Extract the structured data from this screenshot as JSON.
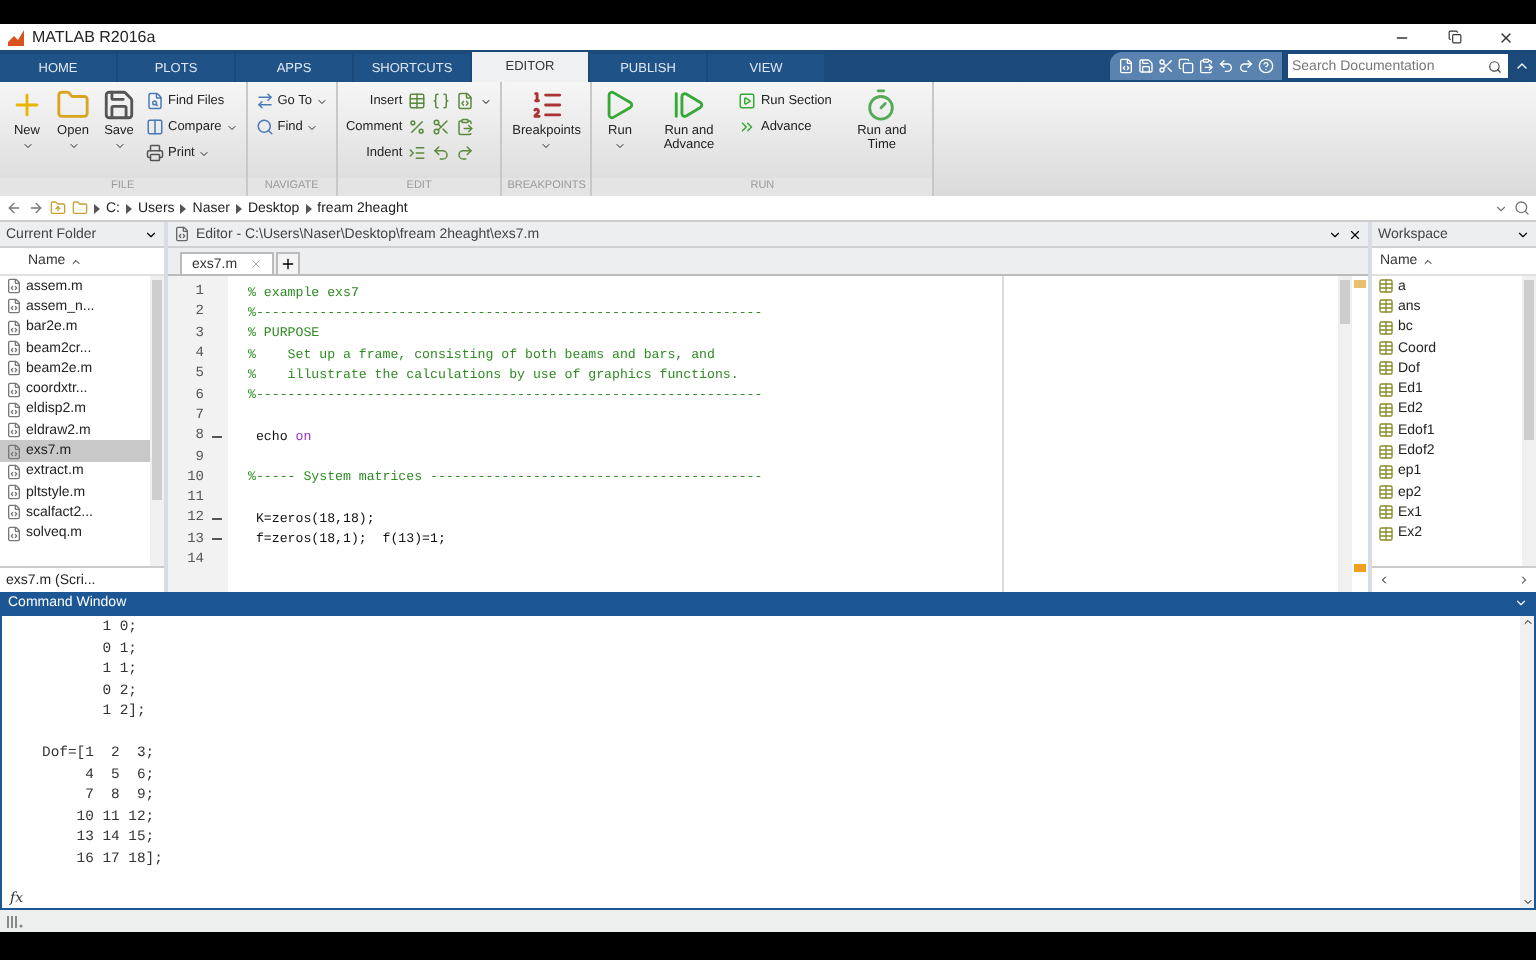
{
  "window": {
    "title": "MATLAB R2016a"
  },
  "tabs": [
    {
      "label": "HOME",
      "selected": false
    },
    {
      "label": "PLOTS",
      "selected": false
    },
    {
      "label": "APPS",
      "selected": false
    },
    {
      "label": "SHORTCUTS",
      "selected": false
    },
    {
      "label": "EDITOR",
      "selected": true
    },
    {
      "label": "PUBLISH",
      "selected": false
    },
    {
      "label": "VIEW",
      "selected": false
    }
  ],
  "search": {
    "placeholder": "Search Documentation"
  },
  "toolstrip": [
    {
      "label": "FILE",
      "columns": [
        {
          "kind": "large",
          "label": "New",
          "menu": true
        },
        {
          "kind": "large",
          "label": "Open",
          "menu": true
        },
        {
          "kind": "large",
          "label": "Save",
          "menu": true
        },
        {
          "kind": "stack",
          "buttons": [
            {
              "label": "Find Files",
              "menu": false
            },
            {
              "label": "Compare",
              "menu": true
            },
            {
              "label": "Print",
              "menu": true
            }
          ]
        }
      ]
    },
    {
      "label": "NAVIGATE",
      "columns": [
        {
          "kind": "stack",
          "buttons": [
            {
              "label": "Go To",
              "menu": true
            },
            {
              "label": "Find",
              "menu": true
            }
          ]
        }
      ]
    },
    {
      "label": "EDIT",
      "columns": [
        {
          "kind": "tools",
          "buttons": [
            {
              "label": "Insert",
              "menu": true
            },
            {
              "label": "Comment",
              "menu": false
            },
            {
              "label": "Indent",
              "menu": false
            }
          ]
        }
      ]
    },
    {
      "label": "BREAKPOINTS",
      "columns": [
        {
          "kind": "large",
          "label": "Breakpoints",
          "menu": true
        }
      ]
    },
    {
      "label": "RUN",
      "columns": [
        {
          "kind": "large",
          "label": "Run",
          "menu": true
        },
        {
          "kind": "large",
          "label": "Run and Advance",
          "menu": false
        },
        {
          "kind": "stack",
          "buttons": [
            {
              "label": "Run Section",
              "menu": false
            },
            {
              "label": "Advance",
              "menu": false
            }
          ]
        },
        {
          "kind": "large",
          "label": "Run and Time",
          "menu": false
        }
      ]
    }
  ],
  "path": [
    "C:",
    "Users",
    "Naser",
    "Desktop",
    "fream 2heaght"
  ],
  "current_folder": {
    "title": "Current Folder",
    "column": "Name",
    "files": [
      {
        "name": "assem.m",
        "selected": false
      },
      {
        "name": "assem_n...",
        "selected": false
      },
      {
        "name": "bar2e.m",
        "selected": false
      },
      {
        "name": "beam2cr...",
        "selected": false
      },
      {
        "name": "beam2e.m",
        "selected": false
      },
      {
        "name": "coordxtr...",
        "selected": false
      },
      {
        "name": "eldisp2.m",
        "selected": false
      },
      {
        "name": "eldraw2.m",
        "selected": false
      },
      {
        "name": "exs7.m",
        "selected": true
      },
      {
        "name": "extract.m",
        "selected": false
      },
      {
        "name": "pltstyle.m",
        "selected": false
      },
      {
        "name": "scalfact2...",
        "selected": false
      },
      {
        "name": "solveq.m",
        "selected": false
      }
    ],
    "details": "exs7.m  (Scri..."
  },
  "editor": {
    "title": "Editor - C:\\Users\\Naser\\Desktop\\fream 2heaght\\exs7.m",
    "tabs": [
      {
        "label": "exs7.m",
        "selected": true
      }
    ],
    "lines": [
      {
        "number": "1",
        "executable": false,
        "parts": [
          {
            "kind": "comment",
            "text": "% example exs7"
          }
        ]
      },
      {
        "number": "2",
        "executable": false,
        "parts": [
          {
            "kind": "comment",
            "text": "%----------------------------------------------------------------"
          }
        ]
      },
      {
        "number": "3",
        "executable": false,
        "parts": [
          {
            "kind": "comment",
            "text": "% PURPOSE"
          }
        ]
      },
      {
        "number": "4",
        "executable": false,
        "parts": [
          {
            "kind": "comment",
            "text": "%    Set up a frame, consisting of both beams and bars, and"
          }
        ]
      },
      {
        "number": "5",
        "executable": false,
        "parts": [
          {
            "kind": "comment",
            "text": "%    illustrate the calculations by use of graphics functions."
          }
        ]
      },
      {
        "number": "6",
        "executable": false,
        "parts": [
          {
            "kind": "comment",
            "text": "%----------------------------------------------------------------"
          }
        ]
      },
      {
        "number": "7",
        "executable": false
      },
      {
        "number": "8",
        "executable": true,
        "parts": [
          {
            "kind": "code",
            "text": " echo "
          },
          {
            "kind": "keyword",
            "text": "on"
          }
        ]
      },
      {
        "number": "9",
        "executable": false
      },
      {
        "number": "10",
        "executable": false,
        "parts": [
          {
            "kind": "comment",
            "text": "%----- System matrices ------------------------------------------"
          }
        ]
      },
      {
        "number": "11",
        "executable": false
      },
      {
        "number": "12",
        "executable": true,
        "parts": [
          {
            "kind": "code",
            "text": " K=zeros(18,18);"
          }
        ]
      },
      {
        "number": "13",
        "executable": true,
        "parts": [
          {
            "kind": "code",
            "text": " f=zeros(18,1);  f(13)=1;"
          }
        ]
      },
      {
        "number": "14",
        "executable": false
      }
    ]
  },
  "workspace": {
    "title": "Workspace",
    "column": "Name",
    "variables": [
      "a",
      "ans",
      "bc",
      "Coord",
      "Dof",
      "Ed1",
      "Ed2",
      "Edof1",
      "Edof2",
      "ep1",
      "ep2",
      "Ex1",
      "Ex2"
    ]
  },
  "command_window": {
    "title": "Command Window",
    "blocks": [
      [
        "       1 0;",
        "       0 1;",
        "       1 1;",
        "       0 2;",
        "       1 2];"
      ],
      [
        "Dof=[1  2  3;",
        "     4  5  6;",
        "     7  8  9;",
        "    10 11 12;",
        "    13 14 15;",
        "    16 17 18];"
      ]
    ],
    "prompt": "fx"
  }
}
